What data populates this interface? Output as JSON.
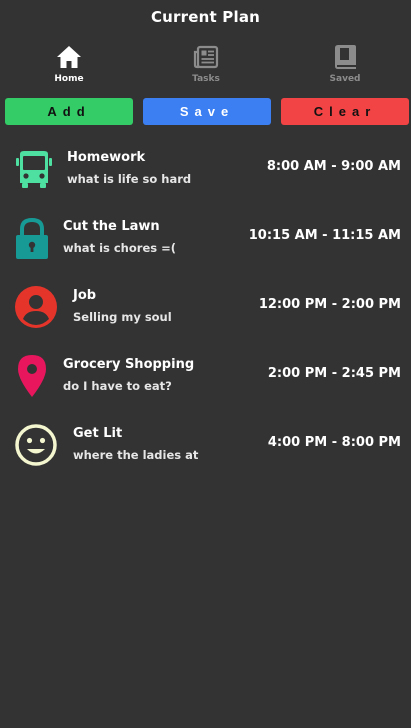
{
  "header": {
    "title": "Current Plan"
  },
  "tabs": [
    {
      "label": "Home",
      "icon": "home-icon",
      "active": true
    },
    {
      "label": "Tasks",
      "icon": "newspaper-icon",
      "active": false
    },
    {
      "label": "Saved",
      "icon": "book-icon",
      "active": false
    }
  ],
  "actions": {
    "add_label": "Add",
    "save_label": "Save",
    "clear_label": "Clear",
    "add_color": "#33cc66",
    "save_color": "#3b7ff2",
    "clear_color": "#f24444"
  },
  "plan": [
    {
      "title": "Homework",
      "subtitle": "what is life so hard",
      "time": "8:00 AM - 9:00 AM",
      "icon": "bus-icon",
      "icon_color": "#4ee0a0"
    },
    {
      "title": "Cut the Lawn",
      "subtitle": "what is chores =(",
      "time": "10:15 AM - 11:15 AM",
      "icon": "lock-icon",
      "icon_color": "#179a96"
    },
    {
      "title": "Job",
      "subtitle": "Selling my soul",
      "time": "12:00 PM - 2:00 PM",
      "icon": "person-icon",
      "icon_color": "#e5352b"
    },
    {
      "title": "Grocery Shopping",
      "subtitle": "do I have to eat?",
      "time": "2:00 PM - 2:45 PM",
      "icon": "map-pin-icon",
      "icon_color": "#e8175d"
    },
    {
      "title": "Get Lit",
      "subtitle": "where the ladies at",
      "time": "4:00 PM - 8:00 PM",
      "icon": "smiley-icon",
      "icon_color": "#f3f6cf"
    }
  ]
}
